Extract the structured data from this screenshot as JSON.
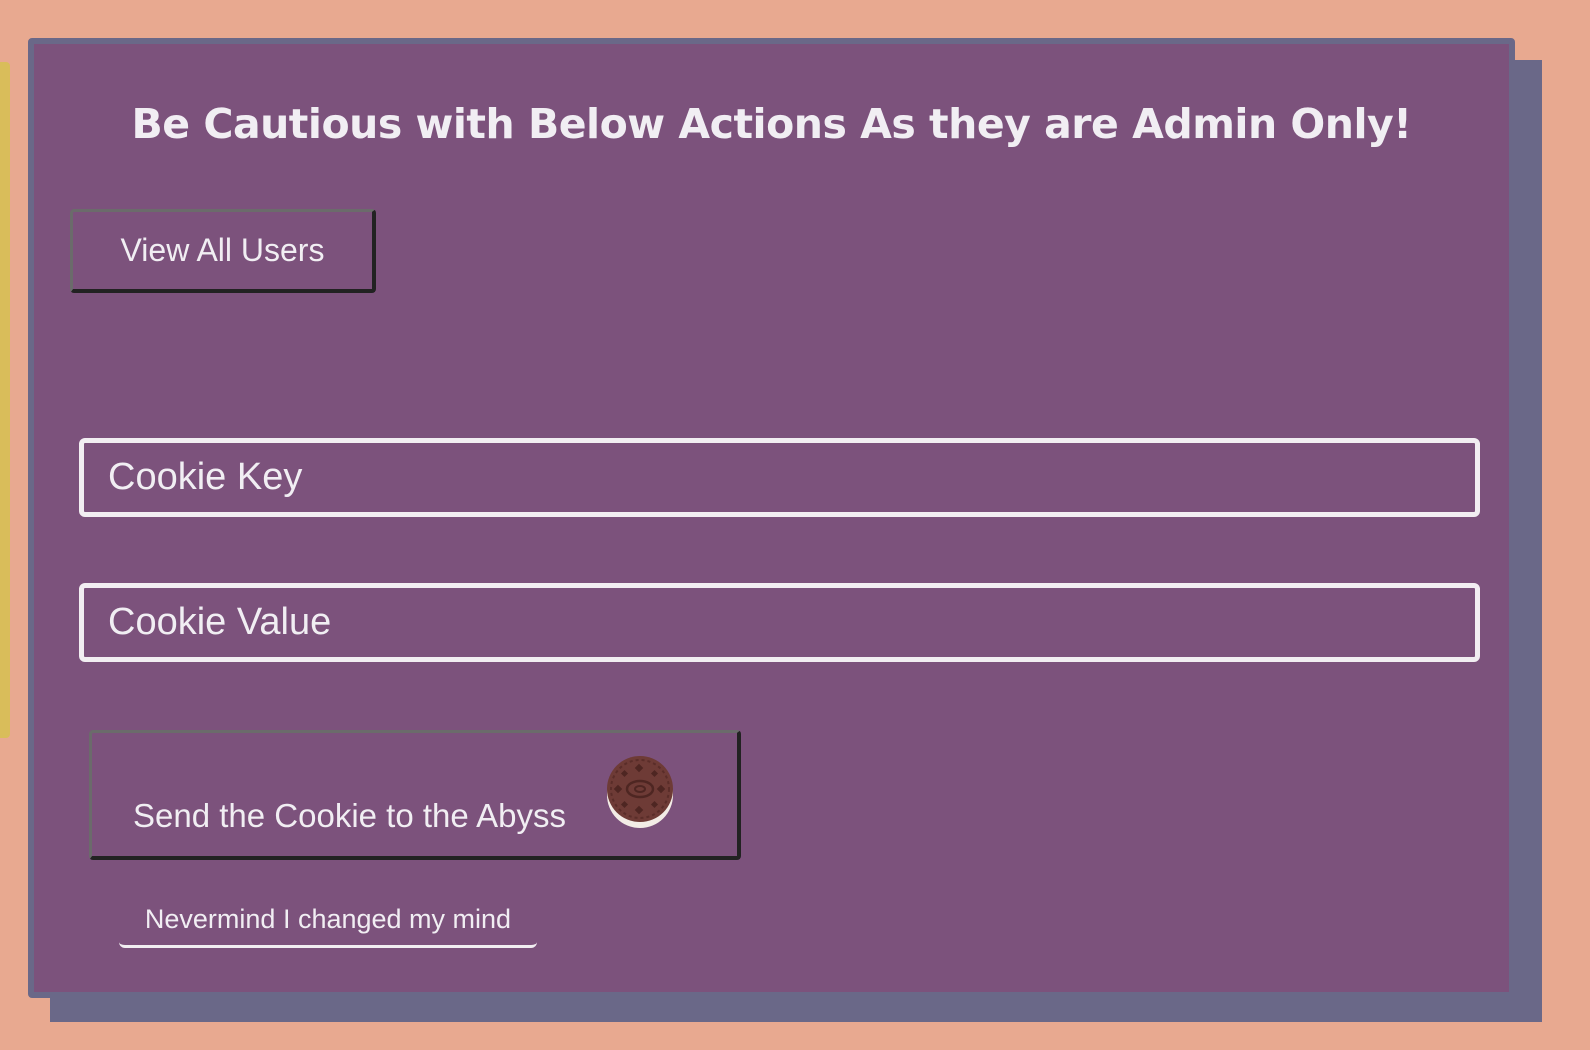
{
  "panel": {
    "title": "Be Cautious with Below Actions As they are Admin Only!",
    "view_users_label": "View All Users",
    "cookie_key_placeholder": "Cookie Key",
    "cookie_value_placeholder": "Cookie Value",
    "send_cookie_label": "Send the Cookie to the Abyss",
    "send_cookie_icon": "cookie-icon",
    "cancel_label": "Nevermind I changed my mind"
  },
  "colors": {
    "page_background": "#e8a990",
    "panel_background": "#7c527c",
    "panel_border": "#6a6888",
    "text": "#f1eef3",
    "accent_strip": "#d9bd5a"
  }
}
